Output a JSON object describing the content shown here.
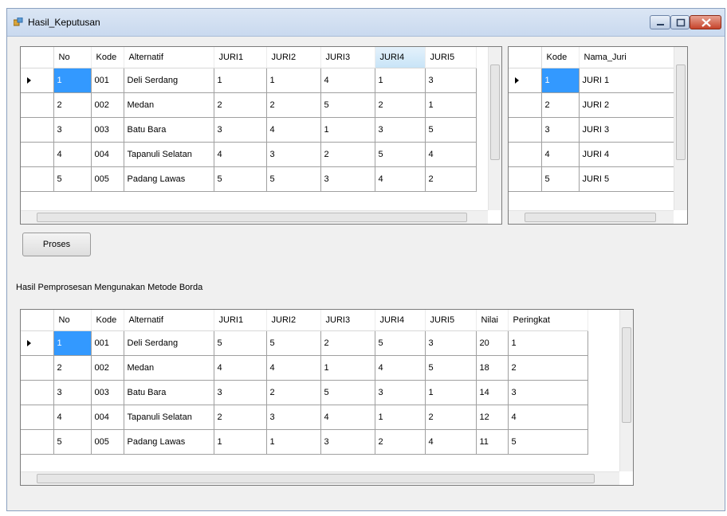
{
  "window": {
    "title": "Hasil_Keputusan"
  },
  "table1": {
    "columns": [
      "No",
      "Kode",
      "Alternatif",
      "JURI1",
      "JURI2",
      "JURI3",
      "JURI4",
      "JURI5"
    ],
    "rows": [
      [
        "1",
        "001",
        "Deli Serdang",
        "1",
        "1",
        "4",
        "1",
        "3"
      ],
      [
        "2",
        "002",
        "Medan",
        "2",
        "2",
        "5",
        "2",
        "1"
      ],
      [
        "3",
        "003",
        "Batu Bara",
        "3",
        "4",
        "1",
        "3",
        "5"
      ],
      [
        "4",
        "004",
        "Tapanuli Selatan",
        "4",
        "3",
        "2",
        "5",
        "4"
      ],
      [
        "5",
        "005",
        "Padang Lawas",
        "5",
        "5",
        "3",
        "4",
        "2"
      ]
    ]
  },
  "table2": {
    "columns": [
      "Kode",
      "Nama_Juri"
    ],
    "rows": [
      [
        "1",
        "JURI 1"
      ],
      [
        "2",
        "JURI 2"
      ],
      [
        "3",
        "JURI 3"
      ],
      [
        "4",
        "JURI 4"
      ],
      [
        "5",
        "JURI 5"
      ]
    ]
  },
  "proses_button": "Proses",
  "result_label": "Hasil Pemprosesan Mengunakan Metode Borda",
  "table3": {
    "columns": [
      "No",
      "Kode",
      "Alternatif",
      "JURI1",
      "JURI2",
      "JURI3",
      "JURI4",
      "JURI5",
      "Nilai",
      "Peringkat"
    ],
    "rows": [
      [
        "1",
        "001",
        "Deli Serdang",
        "5",
        "5",
        "2",
        "5",
        "3",
        "20",
        "1"
      ],
      [
        "2",
        "002",
        "Medan",
        "4",
        "4",
        "1",
        "4",
        "5",
        "18",
        "2"
      ],
      [
        "3",
        "003",
        "Batu Bara",
        "3",
        "2",
        "5",
        "3",
        "1",
        "14",
        "3"
      ],
      [
        "4",
        "004",
        "Tapanuli Selatan",
        "2",
        "3",
        "4",
        "1",
        "2",
        "12",
        "4"
      ],
      [
        "5",
        "005",
        "Padang Lawas",
        "1",
        "1",
        "3",
        "2",
        "4",
        "11",
        "5"
      ]
    ]
  },
  "colors": {
    "selection": "#3399ff",
    "window_border": "#8aa0bf",
    "close_button": "#c6432b"
  }
}
